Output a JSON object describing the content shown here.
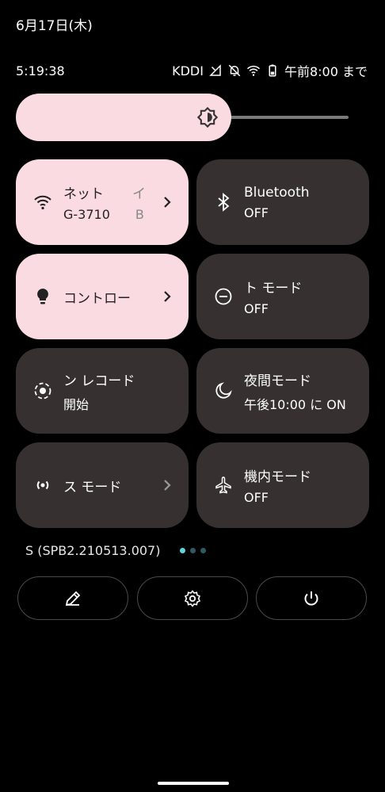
{
  "header": {
    "date": "6月17日(木)"
  },
  "status_bar": {
    "time": "5:19:38",
    "carrier": "KDDI",
    "alarm_text": "午前8:00 まで",
    "icons": [
      "volte-icon",
      "mute-bell-icon",
      "wifi-icon",
      "battery-icon"
    ]
  },
  "brightness": {
    "level": 0.62,
    "icon": "brightness-icon"
  },
  "tiles": [
    {
      "title": "ネット",
      "title_extra": "イ",
      "subtitle": "G-3710",
      "subtitle_extra": "B",
      "state": "on",
      "icon": "wifi-icon",
      "chevron": true
    },
    {
      "title": "Bluetooth",
      "subtitle": "OFF",
      "state": "off",
      "icon": "bluetooth-icon",
      "chevron": false
    },
    {
      "title": "コントロー",
      "subtitle": "",
      "state": "on",
      "icon": "lightbulb-icon",
      "chevron": true
    },
    {
      "title": "ト モード",
      "subtitle": "OFF",
      "state": "off",
      "icon": "do-not-disturb-icon",
      "chevron": false
    },
    {
      "title": "ン レコード",
      "subtitle": "開始",
      "state": "off",
      "icon": "screen-record-icon",
      "chevron": false
    },
    {
      "title": "夜間モード",
      "subtitle": "午後10:00 に ON",
      "state": "off",
      "icon": "moon-icon",
      "chevron": false
    },
    {
      "title": "ス モード",
      "subtitle": "",
      "state": "off",
      "icon": "cast-icon",
      "chevron": true
    },
    {
      "title": "機内モード",
      "subtitle": "OFF",
      "state": "off",
      "icon": "airplane-icon",
      "chevron": false
    }
  ],
  "footer": {
    "build_number": "S (SPB2.210513.007)",
    "page_indicator": {
      "pages": 3,
      "current": 1
    },
    "buttons": [
      "edit-icon",
      "settings-icon",
      "power-icon"
    ]
  },
  "colors": {
    "background": "#000000",
    "tile_on": "#fbdbe2",
    "tile_off": "#363030",
    "indicator_active": "#5fd4e3"
  }
}
